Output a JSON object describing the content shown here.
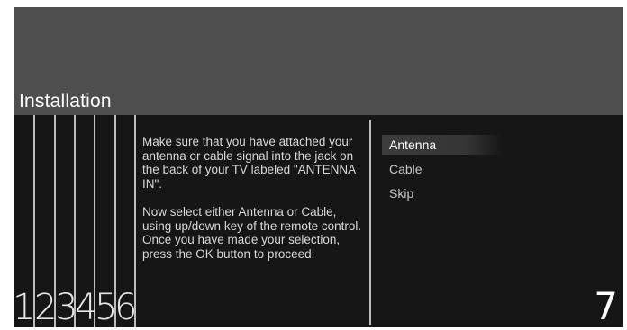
{
  "header": {
    "title": "Installation"
  },
  "steps": [
    "1",
    "2",
    "3",
    "4",
    "5",
    "6",
    "7"
  ],
  "instructions": {
    "paragraph1": "Make sure that you have attached your antenna or cable signal into the jack on the back of your TV labeled \"ANTENNA IN\".",
    "paragraph2": "Now select either Antenna or Cable, using up/down key of the remote control. Once you have made your selection, press the OK button to proceed."
  },
  "options": [
    {
      "label": "Antenna",
      "selected": true
    },
    {
      "label": "Cable",
      "selected": false
    },
    {
      "label": "Skip",
      "selected": false
    }
  ],
  "colors": {
    "header_bg": "#4e4e4e",
    "content_bg": "#161616",
    "text": "#d8d8d8",
    "highlight": "#3c3c3c"
  }
}
